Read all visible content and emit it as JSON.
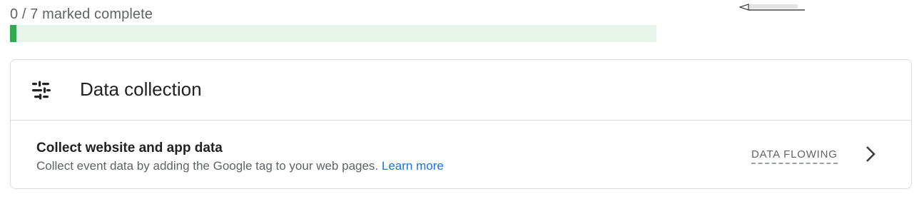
{
  "progress": {
    "label": "0 / 7 marked complete",
    "completed": 0,
    "total": 7,
    "fraction": 0.01,
    "fill_color": "#34a853",
    "track_color": "#e6f4ea"
  },
  "section": {
    "title": "Data collection",
    "icon": "tune-icon",
    "rows": [
      {
        "title": "Collect website and app data",
        "description": "Collect event data by adding the Google tag to your web pages.",
        "link_text": "Learn more",
        "status": "DATA FLOWING",
        "chevron_icon": "chevron-right-icon"
      }
    ]
  },
  "colors": {
    "link": "#1a73e8",
    "text_secondary": "#5f6368",
    "border": "#dadce0"
  }
}
